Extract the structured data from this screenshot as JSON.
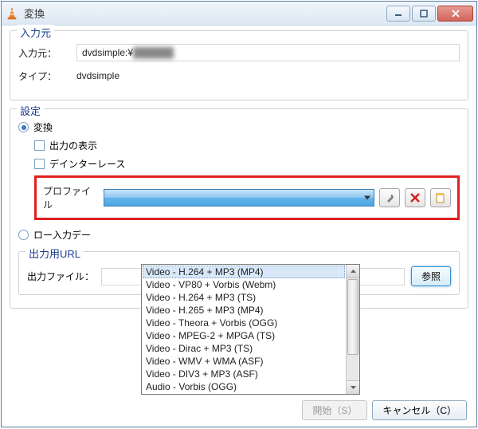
{
  "window": {
    "title": "変換"
  },
  "source": {
    "legend": "入力元",
    "path_label": "入力元：",
    "path_value": "dvdsimple:¥",
    "type_label": "タイプ：",
    "type_value": "dvdsimple"
  },
  "settings": {
    "legend": "設定",
    "convert_label": "変換",
    "show_output_label": "出力の表示",
    "deinterlace_label": "デインターレース",
    "profile_label": "プロファイル",
    "profile_selected": "Video - H.264 + MP3 (MP4)",
    "profile_options": [
      "Video - H.264 + MP3 (MP4)",
      "Video - VP80 + Vorbis (Webm)",
      "Video - H.264 + MP3 (TS)",
      "Video - H.265 + MP3 (MP4)",
      "Video - Theora + Vorbis (OGG)",
      "Video - MPEG-2 + MPGA (TS)",
      "Video - Dirac + MP3 (TS)",
      "Video - WMV + WMA (ASF)",
      "Video - DIV3 + MP3 (ASF)",
      "Audio - Vorbis (OGG)"
    ],
    "raw_input_label": "ロー入力デー"
  },
  "output": {
    "legend": "出力用URL",
    "file_label": "出力ファイル：",
    "browse_label": "参照"
  },
  "footer": {
    "start_label": "開始（S）",
    "cancel_label": "キャンセル（C）"
  },
  "icons": {
    "wrench": "wrench-icon",
    "delete": "delete-icon",
    "new": "new-profile-icon"
  }
}
